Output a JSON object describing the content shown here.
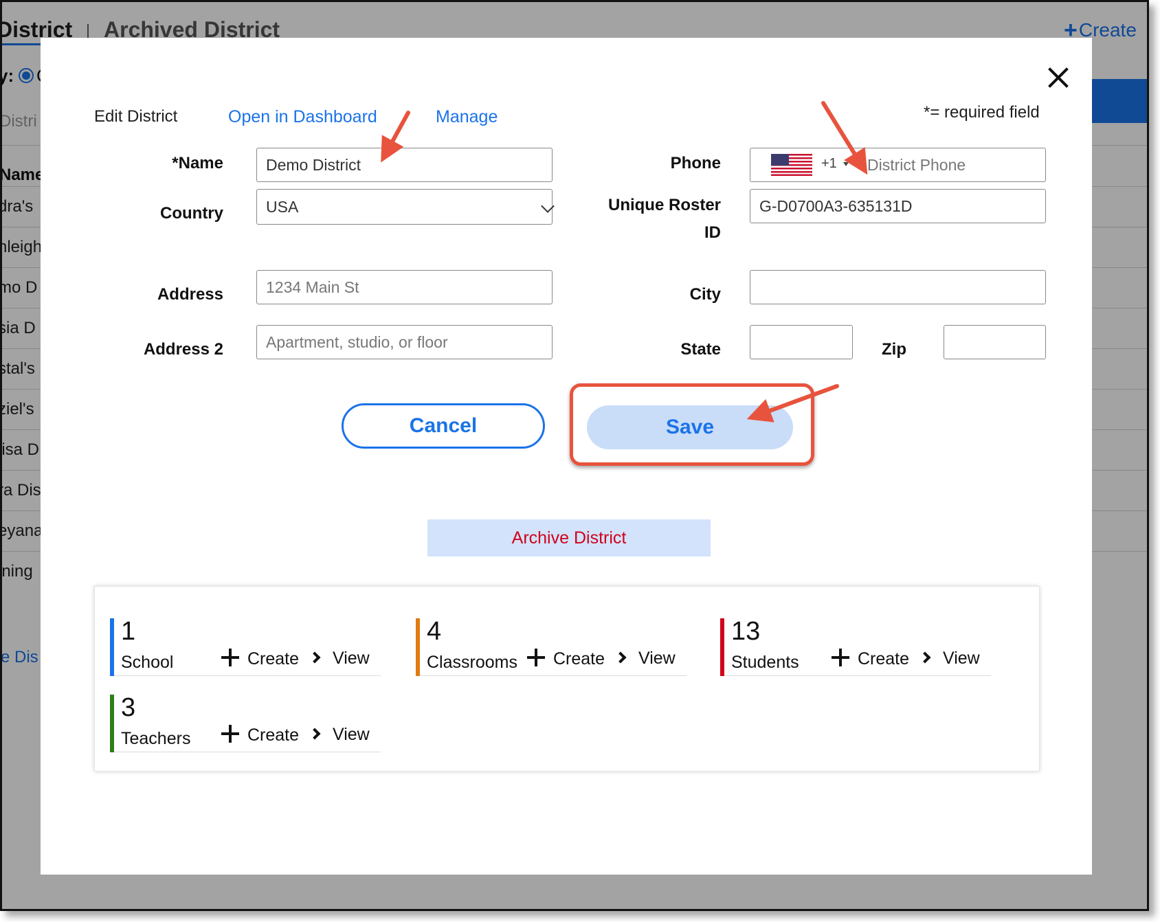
{
  "background": {
    "tab_active": "District",
    "tab_archived": "Archived District",
    "create_label": "Create",
    "radio_label": "y:",
    "radio_tail": "C",
    "search_placeholder": "Distri",
    "column_header": "Name",
    "rows": [
      "dra's",
      "nleigh",
      "mo D",
      "sia D",
      "stal's",
      "ziel's",
      "lisa D",
      "ra Dis",
      "eyana",
      "ining"
    ],
    "link": "e Dis"
  },
  "modal": {
    "title": "Edit District",
    "open_dashboard": "Open in Dashboard",
    "manage": "Manage",
    "required_note": "*= required field",
    "fields": {
      "name_label": "*Name",
      "name_value": "Demo District",
      "country_label": "Country",
      "country_value": "USA",
      "address_label": "Address",
      "address_placeholder": "1234 Main St",
      "address2_label": "Address 2",
      "address2_placeholder": "Apartment, studio, or floor",
      "phone_label": "Phone",
      "phone_dial_code": "+1",
      "phone_flag": "us-flag-icon",
      "phone_placeholder": "District Phone",
      "roster_label_line1": "Unique Roster",
      "roster_label_line2": "ID",
      "roster_value": "G-D0700A3-635131D",
      "city_label": "City",
      "city_value": "",
      "state_label": "State",
      "state_value": "",
      "zip_label": "Zip",
      "zip_value": ""
    },
    "cancel_label": "Cancel",
    "save_label": "Save",
    "archive_label": "Archive District",
    "stats": [
      {
        "count": "1",
        "label": "School",
        "create": "Create",
        "view": "View",
        "color": "#1a73e8"
      },
      {
        "count": "4",
        "label": "Classrooms",
        "create": "Create",
        "view": "View",
        "color": "#e07b12"
      },
      {
        "count": "13",
        "label": "Students",
        "create": "Create",
        "view": "View",
        "color": "#d0021b"
      },
      {
        "count": "3",
        "label": "Teachers",
        "create": "Create",
        "view": "View",
        "color": "#2f7d16"
      }
    ]
  },
  "colors": {
    "accent": "#1a73e8",
    "danger": "#d0021b",
    "annotation": "#e8533d",
    "save_bg": "#c9dcf8"
  }
}
